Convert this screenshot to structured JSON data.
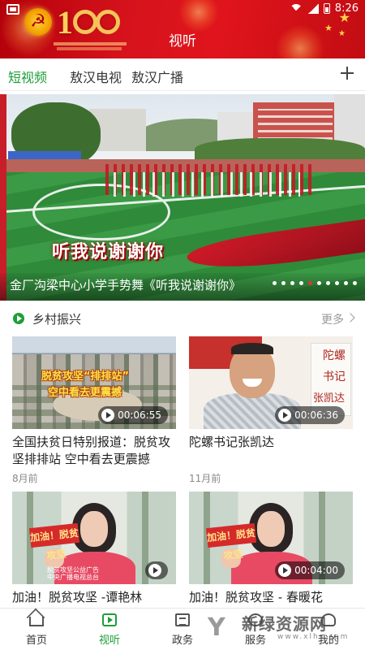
{
  "status_bar": {
    "time": "8:26"
  },
  "header": {
    "title": "视听"
  },
  "tabs": [
    {
      "label": "短视频",
      "active": true
    },
    {
      "label": "敖汉电视",
      "active": false
    },
    {
      "label": "敖汉广播",
      "active": false
    }
  ],
  "banner": {
    "overlay_text": "听我说谢谢你",
    "caption": "金厂沟梁中心小学手势舞《听我说谢谢你》",
    "dots_total": 10,
    "active_dot": 5
  },
  "section": {
    "title": "乡村振兴",
    "more_label": "更多"
  },
  "videos": [
    {
      "title": "全国扶贫日特别报道：脱贫攻坚排排站 空中看去更震撼",
      "duration": "00:06:55",
      "time_ago": "8月前",
      "thumb_text_1": "脱贫攻坚“排排站”",
      "thumb_text_2": "空中看去更震撼"
    },
    {
      "title": "陀螺书记张凯达",
      "duration": "00:06:36",
      "time_ago": "11月前",
      "thumb_text_1": "陀螺",
      "thumb_text_2": "书记",
      "thumb_text_3": "张凯达"
    },
    {
      "title": "加油！脱贫攻坚 -谭艳林",
      "duration": "",
      "sign": "加油！脱贫攻坚",
      "thumb_label": "脱贫攻坚公益广告 中央广播电视总台"
    },
    {
      "title": "加油！脱贫攻坚 - 春暖花",
      "duration": "00:04:00",
      "sign": "加油！脱贫攻坚"
    }
  ],
  "bottom_nav": [
    {
      "label": "首页",
      "icon": "home-icon",
      "active": false
    },
    {
      "label": "视听",
      "icon": "video-icon",
      "active": true
    },
    {
      "label": "政务",
      "icon": "news-icon",
      "active": false
    },
    {
      "label": "服务",
      "icon": "service-icon",
      "active": false
    },
    {
      "label": "我的",
      "icon": "profile-icon",
      "active": false
    }
  ],
  "watermark": {
    "text": "新绿资源网",
    "sub": "www.xlhs.com"
  },
  "colors": {
    "header_red": "#d6131c",
    "accent_green": "#1e9e38",
    "dot_active": "#e2342d"
  }
}
